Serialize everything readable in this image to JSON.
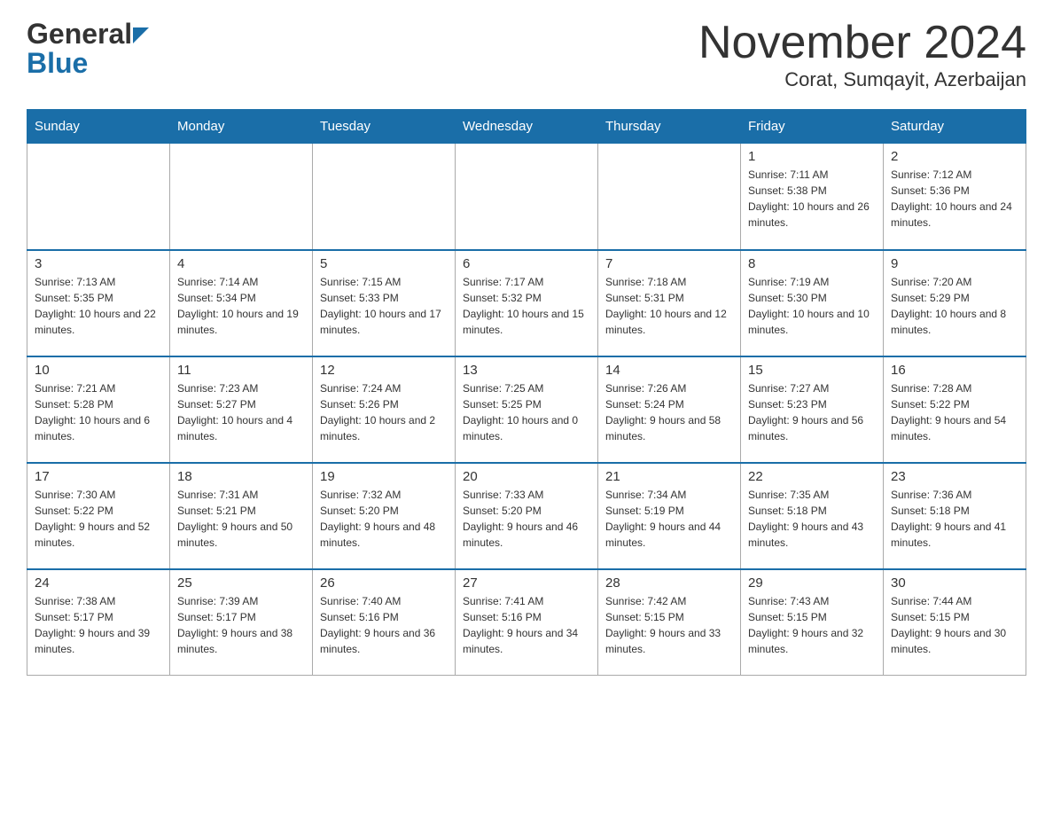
{
  "header": {
    "logo_general": "General",
    "logo_blue": "Blue",
    "title": "November 2024",
    "subtitle": "Corat, Sumqayit, Azerbaijan"
  },
  "days_of_week": [
    "Sunday",
    "Monday",
    "Tuesday",
    "Wednesday",
    "Thursday",
    "Friday",
    "Saturday"
  ],
  "weeks": [
    [
      {
        "day": "",
        "info": ""
      },
      {
        "day": "",
        "info": ""
      },
      {
        "day": "",
        "info": ""
      },
      {
        "day": "",
        "info": ""
      },
      {
        "day": "",
        "info": ""
      },
      {
        "day": "1",
        "info": "Sunrise: 7:11 AM\nSunset: 5:38 PM\nDaylight: 10 hours and 26 minutes."
      },
      {
        "day": "2",
        "info": "Sunrise: 7:12 AM\nSunset: 5:36 PM\nDaylight: 10 hours and 24 minutes."
      }
    ],
    [
      {
        "day": "3",
        "info": "Sunrise: 7:13 AM\nSunset: 5:35 PM\nDaylight: 10 hours and 22 minutes."
      },
      {
        "day": "4",
        "info": "Sunrise: 7:14 AM\nSunset: 5:34 PM\nDaylight: 10 hours and 19 minutes."
      },
      {
        "day": "5",
        "info": "Sunrise: 7:15 AM\nSunset: 5:33 PM\nDaylight: 10 hours and 17 minutes."
      },
      {
        "day": "6",
        "info": "Sunrise: 7:17 AM\nSunset: 5:32 PM\nDaylight: 10 hours and 15 minutes."
      },
      {
        "day": "7",
        "info": "Sunrise: 7:18 AM\nSunset: 5:31 PM\nDaylight: 10 hours and 12 minutes."
      },
      {
        "day": "8",
        "info": "Sunrise: 7:19 AM\nSunset: 5:30 PM\nDaylight: 10 hours and 10 minutes."
      },
      {
        "day": "9",
        "info": "Sunrise: 7:20 AM\nSunset: 5:29 PM\nDaylight: 10 hours and 8 minutes."
      }
    ],
    [
      {
        "day": "10",
        "info": "Sunrise: 7:21 AM\nSunset: 5:28 PM\nDaylight: 10 hours and 6 minutes."
      },
      {
        "day": "11",
        "info": "Sunrise: 7:23 AM\nSunset: 5:27 PM\nDaylight: 10 hours and 4 minutes."
      },
      {
        "day": "12",
        "info": "Sunrise: 7:24 AM\nSunset: 5:26 PM\nDaylight: 10 hours and 2 minutes."
      },
      {
        "day": "13",
        "info": "Sunrise: 7:25 AM\nSunset: 5:25 PM\nDaylight: 10 hours and 0 minutes."
      },
      {
        "day": "14",
        "info": "Sunrise: 7:26 AM\nSunset: 5:24 PM\nDaylight: 9 hours and 58 minutes."
      },
      {
        "day": "15",
        "info": "Sunrise: 7:27 AM\nSunset: 5:23 PM\nDaylight: 9 hours and 56 minutes."
      },
      {
        "day": "16",
        "info": "Sunrise: 7:28 AM\nSunset: 5:22 PM\nDaylight: 9 hours and 54 minutes."
      }
    ],
    [
      {
        "day": "17",
        "info": "Sunrise: 7:30 AM\nSunset: 5:22 PM\nDaylight: 9 hours and 52 minutes."
      },
      {
        "day": "18",
        "info": "Sunrise: 7:31 AM\nSunset: 5:21 PM\nDaylight: 9 hours and 50 minutes."
      },
      {
        "day": "19",
        "info": "Sunrise: 7:32 AM\nSunset: 5:20 PM\nDaylight: 9 hours and 48 minutes."
      },
      {
        "day": "20",
        "info": "Sunrise: 7:33 AM\nSunset: 5:20 PM\nDaylight: 9 hours and 46 minutes."
      },
      {
        "day": "21",
        "info": "Sunrise: 7:34 AM\nSunset: 5:19 PM\nDaylight: 9 hours and 44 minutes."
      },
      {
        "day": "22",
        "info": "Sunrise: 7:35 AM\nSunset: 5:18 PM\nDaylight: 9 hours and 43 minutes."
      },
      {
        "day": "23",
        "info": "Sunrise: 7:36 AM\nSunset: 5:18 PM\nDaylight: 9 hours and 41 minutes."
      }
    ],
    [
      {
        "day": "24",
        "info": "Sunrise: 7:38 AM\nSunset: 5:17 PM\nDaylight: 9 hours and 39 minutes."
      },
      {
        "day": "25",
        "info": "Sunrise: 7:39 AM\nSunset: 5:17 PM\nDaylight: 9 hours and 38 minutes."
      },
      {
        "day": "26",
        "info": "Sunrise: 7:40 AM\nSunset: 5:16 PM\nDaylight: 9 hours and 36 minutes."
      },
      {
        "day": "27",
        "info": "Sunrise: 7:41 AM\nSunset: 5:16 PM\nDaylight: 9 hours and 34 minutes."
      },
      {
        "day": "28",
        "info": "Sunrise: 7:42 AM\nSunset: 5:15 PM\nDaylight: 9 hours and 33 minutes."
      },
      {
        "day": "29",
        "info": "Sunrise: 7:43 AM\nSunset: 5:15 PM\nDaylight: 9 hours and 32 minutes."
      },
      {
        "day": "30",
        "info": "Sunrise: 7:44 AM\nSunset: 5:15 PM\nDaylight: 9 hours and 30 minutes."
      }
    ]
  ],
  "colors": {
    "header_bg": "#1a6ea8",
    "header_text": "#ffffff",
    "border": "#aaaaaa",
    "accent": "#1a6ea8"
  }
}
